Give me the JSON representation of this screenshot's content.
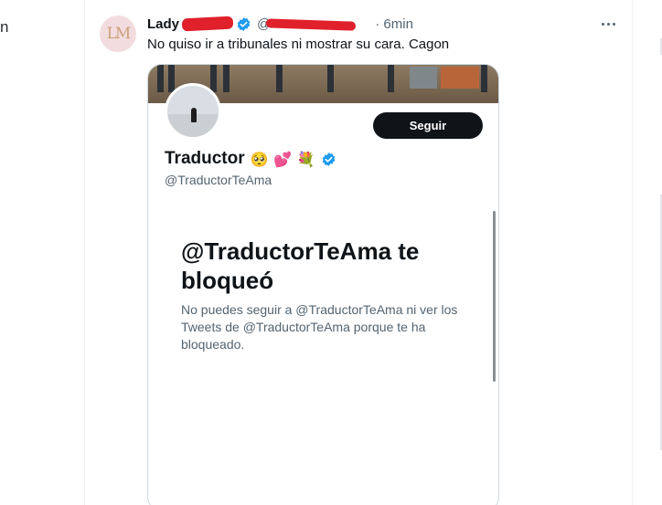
{
  "left_edge_text": "n",
  "tweet": {
    "avatar_monogram": "LM",
    "display_name": "Lady",
    "handle": "@",
    "separator": "·",
    "time": "6min",
    "text": "No quiso ir a tribunales ni mostrar su cara. Cagon"
  },
  "embedded_screenshot": {
    "follow_button": "Seguir",
    "profile_name": "Traductor",
    "profile_emojis": "🥺 💕 💐",
    "profile_handle": "@TraductorTeAma",
    "blocked_title": "@TraductorTeAma te bloqueó",
    "blocked_description": "No puedes seguir a @TraductorTeAma ni ver los Tweets de @TraductorTeAma porque te ha bloqueado."
  },
  "icons": {
    "verified": "verified-badge-icon",
    "more": "more-options-icon"
  },
  "colors": {
    "verified_blue": "#1d9bf0",
    "redaction_red": "#e0202a",
    "follow_button_bg": "#0f1419",
    "secondary_text": "#536471"
  }
}
